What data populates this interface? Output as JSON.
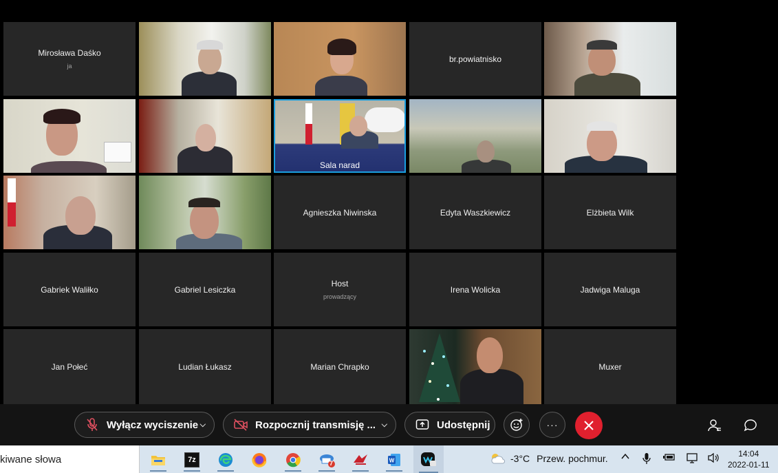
{
  "participants": [
    {
      "name": "Mirosława Daśko",
      "sub": "ja",
      "video": false
    },
    {
      "name": "",
      "video": true
    },
    {
      "name": "",
      "video": true
    },
    {
      "name": "br.powiatnisko",
      "sub": "",
      "video": false
    },
    {
      "name": "",
      "video": true
    },
    {
      "name": "",
      "video": true
    },
    {
      "name": "",
      "video": true
    },
    {
      "name": "Sala narad",
      "video": true,
      "active": true
    },
    {
      "name": "",
      "video": true
    },
    {
      "name": "",
      "video": true
    },
    {
      "name": "",
      "video": true
    },
    {
      "name": "",
      "video": true
    },
    {
      "name": "Agnieszka Niwinska",
      "sub": "",
      "video": false
    },
    {
      "name": "Edyta Waszkiewicz",
      "sub": "",
      "video": false
    },
    {
      "name": "Elżbieta Wilk",
      "sub": "",
      "video": false
    },
    {
      "name": "Gabriek Waliłko",
      "sub": "",
      "video": false
    },
    {
      "name": "Gabriel Lesiczka",
      "sub": "",
      "video": false
    },
    {
      "name": "Host",
      "sub": "prowadzący",
      "video": false
    },
    {
      "name": "Irena Wolicka",
      "sub": "",
      "video": false
    },
    {
      "name": "Jadwiga Maluga",
      "sub": "",
      "video": false
    },
    {
      "name": "Jan Połeć",
      "sub": "",
      "video": false
    },
    {
      "name": "Ludian Łukasz",
      "sub": "",
      "video": false
    },
    {
      "name": "Marian Chrapko",
      "sub": "",
      "video": false
    },
    {
      "name": "",
      "video": true
    },
    {
      "name": "Muxer",
      "sub": "",
      "video": false
    }
  ],
  "controls": {
    "mute_label": "Wyłącz wyciszenie",
    "video_label": "Rozpocznij transmisję ...",
    "share_label": "Udostępnij"
  },
  "taskbar": {
    "search_text": "kiwane słowa",
    "weather_temp": "-3°C",
    "weather_desc": "Przew. pochmur.",
    "time": "14:04",
    "date": "2022-01-11",
    "mail_badge": "7"
  },
  "colors": {
    "tile_bg": "#272727",
    "active_border": "#1a9fe0",
    "leave_red": "#e0202e",
    "taskbar_bg": "#d8e4ef"
  }
}
